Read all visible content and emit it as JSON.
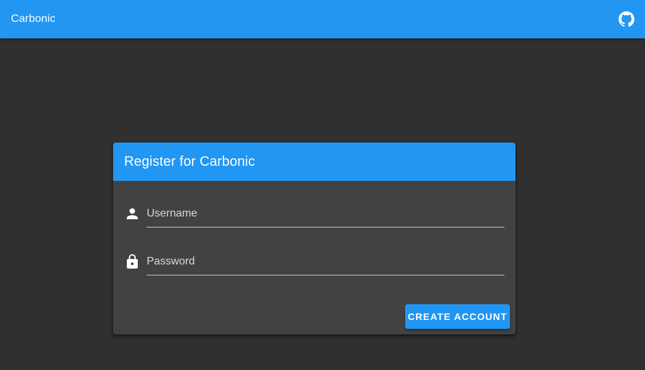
{
  "appbar": {
    "title": "Carbonic",
    "github_icon": "github-icon",
    "color": "#2196f3"
  },
  "card": {
    "title": "Register for Carbonic",
    "username": {
      "icon": "person-icon",
      "placeholder": "Username",
      "value": ""
    },
    "password": {
      "icon": "lock-icon",
      "placeholder": "Password",
      "value": ""
    },
    "create_button_label": "CREATE ACCOUNT"
  },
  "colors": {
    "accent": "#2196f3",
    "background": "#303030",
    "card_background": "#424242"
  }
}
